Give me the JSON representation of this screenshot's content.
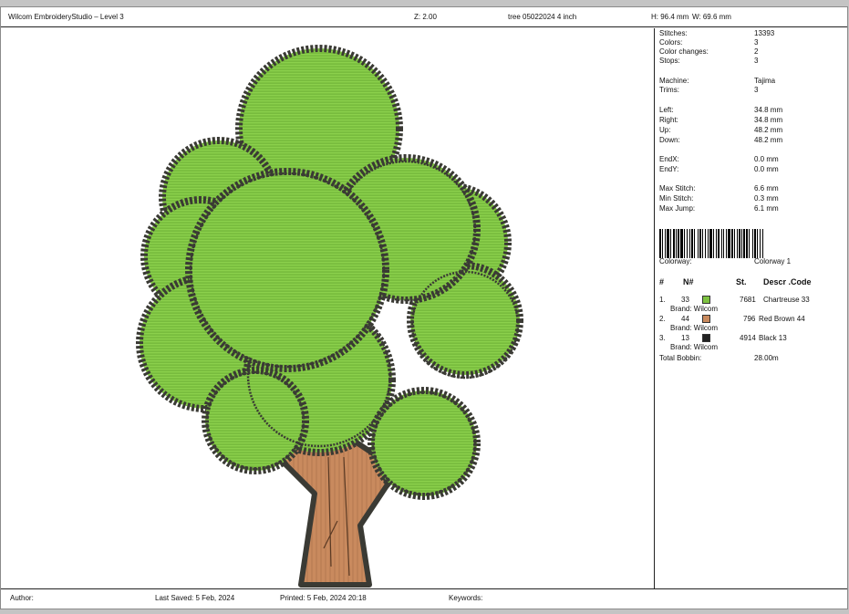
{
  "header": {
    "app": "Wilcom EmbroideryStudio – Level 3",
    "zoom": "Z: 2.00",
    "file": "tree 05022024 4 inch",
    "height": "H: 96.4 mm",
    "width": "W: 69.6 mm"
  },
  "info": {
    "stitches_label": "Stitches:",
    "stitches": "13393",
    "colors_label": "Colors:",
    "colors": "3",
    "color_changes_label": "Color changes:",
    "color_changes": "2",
    "stops_label": "Stops:",
    "stops": "3",
    "machine_label": "Machine:",
    "machine": "Tajima",
    "trims_label": "Trims:",
    "trims": "3",
    "left_label": "Left:",
    "left": "34.8 mm",
    "right_label": "Right:",
    "right": "34.8 mm",
    "up_label": "Up:",
    "up": "48.2 mm",
    "down_label": "Down:",
    "down": "48.2 mm",
    "endx_label": "EndX:",
    "endx": "0.0 mm",
    "endy_label": "EndY:",
    "endy": "0.0 mm",
    "max_stitch_label": "Max Stitch:",
    "max_stitch": "6.6 mm",
    "min_stitch_label": "Min Stitch:",
    "min_stitch": "0.3 mm",
    "max_jump_label": "Max Jump:",
    "max_jump": "6.1 mm",
    "colorway_label": "Colorway:",
    "colorway": "Colorway 1"
  },
  "threads": {
    "headers": {
      "num": "#",
      "n": "N#",
      "st": "St.",
      "desc": "Descr .Code"
    },
    "items": [
      {
        "index": "1.",
        "n": "33",
        "color": "#7dc241",
        "stitches": "7681",
        "desc": "Chartreuse 33",
        "brand": "Brand: Wilcom"
      },
      {
        "index": "2.",
        "n": "44",
        "color": "#c98a5e",
        "stitches": "796",
        "desc": "Red Brown 44",
        "brand": "Brand: Wilcom"
      },
      {
        "index": "3.",
        "n": "13",
        "color": "#222222",
        "stitches": "4914",
        "desc": "Black 13",
        "brand": "Brand: Wilcom"
      }
    ],
    "total_bobbin_label": "Total Bobbin:",
    "total_bobbin": "28.00m"
  },
  "footer": {
    "author": "Author:",
    "last_saved": "Last Saved:  5 Feb, 2024",
    "printed": "Printed:  5 Feb, 2024 20:18",
    "keywords": "Keywords:"
  }
}
